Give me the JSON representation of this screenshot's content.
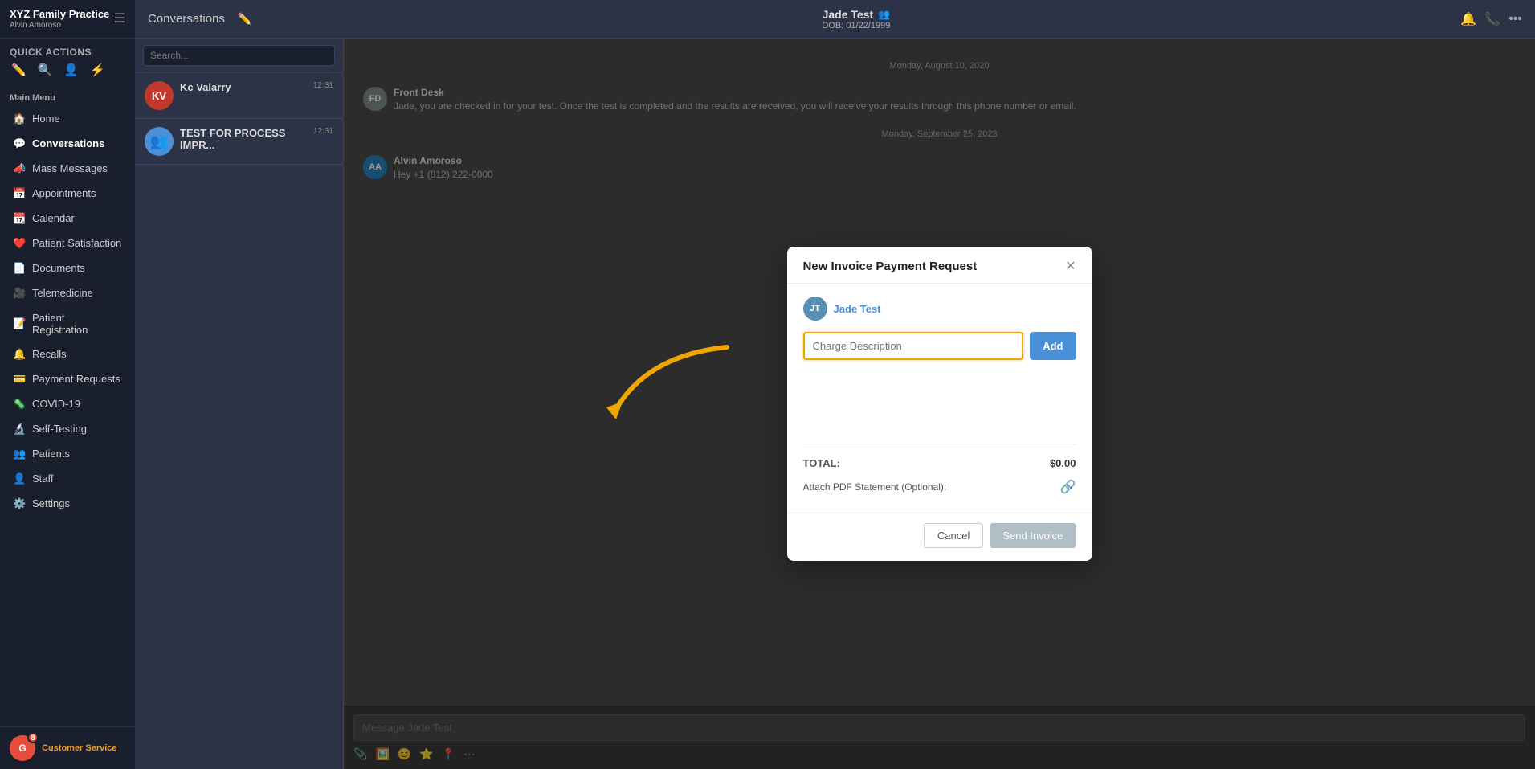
{
  "sidebar": {
    "brand": "XYZ Family Practice",
    "user": "Alvin Amoroso",
    "quick_actions_label": "Quick Actions",
    "main_menu_label": "Main Menu",
    "nav_items": [
      {
        "id": "home",
        "label": "Home",
        "icon": "🏠"
      },
      {
        "id": "conversations",
        "label": "Conversations",
        "icon": "💬"
      },
      {
        "id": "mass-messages",
        "label": "Mass Messages",
        "icon": "📣"
      },
      {
        "id": "appointments",
        "label": "Appointments",
        "icon": "📅"
      },
      {
        "id": "calendar",
        "label": "Calendar",
        "icon": "📆"
      },
      {
        "id": "patient-satisfaction",
        "label": "Patient Satisfaction",
        "icon": "❤️"
      },
      {
        "id": "documents",
        "label": "Documents",
        "icon": "📄"
      },
      {
        "id": "telemedicine",
        "label": "Telemedicine",
        "icon": "🎥"
      },
      {
        "id": "patient-registration",
        "label": "Patient Registration",
        "icon": "📝"
      },
      {
        "id": "recalls",
        "label": "Recalls",
        "icon": "🔔"
      },
      {
        "id": "payment-requests",
        "label": "Payment Requests",
        "icon": "💳"
      },
      {
        "id": "covid-19",
        "label": "COVID-19",
        "icon": "🦠"
      },
      {
        "id": "self-testing",
        "label": "Self-Testing",
        "icon": "🔬"
      },
      {
        "id": "patients",
        "label": "Patients",
        "icon": "👥"
      },
      {
        "id": "staff",
        "label": "Staff",
        "icon": "👤"
      },
      {
        "id": "settings",
        "label": "Settings",
        "icon": "⚙️"
      }
    ],
    "bottom": {
      "avatar_initials": "G",
      "badge_count": "8",
      "label": "Customer Service"
    }
  },
  "topbar": {
    "conversations_label": "Conversations",
    "patient_name": "Jade Test",
    "patient_dob": "DOB: 01/22/1999"
  },
  "conv_list": {
    "search_placeholder": "Search...",
    "items": [
      {
        "name": "Kc Valarry",
        "preview": "",
        "time": "12:31",
        "has_avatar": true,
        "avatar_color": "#c0392b",
        "initials": "KV"
      },
      {
        "name": "TEST FOR PROCESS IMPR...",
        "preview": "",
        "time": "12:31",
        "has_avatar": false,
        "avatar_icon": "👥"
      }
    ]
  },
  "chat": {
    "messages": [
      {
        "date_label": "Monday, August 10, 2020",
        "sender": "Front Desk",
        "sender_initials": "FD",
        "avatar_color": "#7f8c8d",
        "text": "Jade, you are checked in for your test. Once the test is completed and the results are received, you will receive your results through this phone number or email."
      },
      {
        "date_label": "Monday, September 25, 2023",
        "sender": "Alvin Amoroso",
        "sender_initials": "AA",
        "avatar_color": "#2980b9",
        "text": "Hey +1 (812) 222-0000"
      }
    ],
    "input_placeholder": "Message Jade Test"
  },
  "modal": {
    "title": "New Invoice Payment Request",
    "patient_name": "Jade Test",
    "charge_description_placeholder": "Charge Description",
    "add_button_label": "Add",
    "total_label": "TOTAL:",
    "total_value": "$0.00",
    "attach_label": "Attach PDF Statement (Optional):",
    "cancel_label": "Cancel",
    "send_label": "Send Invoice"
  }
}
